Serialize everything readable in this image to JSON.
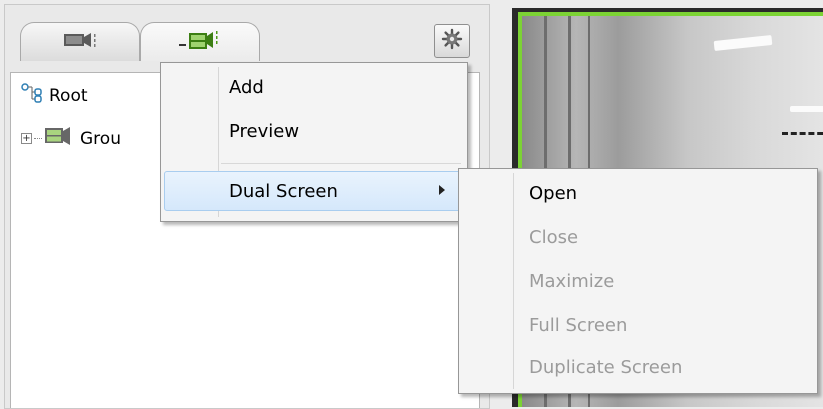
{
  "tree": {
    "root_label": "Root",
    "group_label": "Grou"
  },
  "context_menu": {
    "items": [
      {
        "label": "Add"
      },
      {
        "label": "Preview"
      },
      {
        "label": "Dual Screen"
      }
    ]
  },
  "dual_screen_submenu": {
    "items": [
      {
        "label": "Open",
        "enabled": true
      },
      {
        "label": "Close",
        "enabled": false
      },
      {
        "label": "Maximize",
        "enabled": false
      },
      {
        "label": "Full Screen",
        "enabled": false
      },
      {
        "label": "Duplicate Screen",
        "enabled": false
      }
    ]
  },
  "icons": {
    "camera_tab": "camera-icon",
    "group_tab": "camera-group-icon",
    "settings": "gear-icon",
    "root_node": "tree-root-icon",
    "group_node": "camera-group-icon",
    "expander": "expand-plus-icon",
    "submenu": "chevron-right-icon"
  },
  "colors": {
    "video_border": "#7cd334",
    "group_tab_icon": "#4e9a1a",
    "menu_highlight": "#d5e8fb",
    "disabled_text": "#9b9b9b"
  }
}
